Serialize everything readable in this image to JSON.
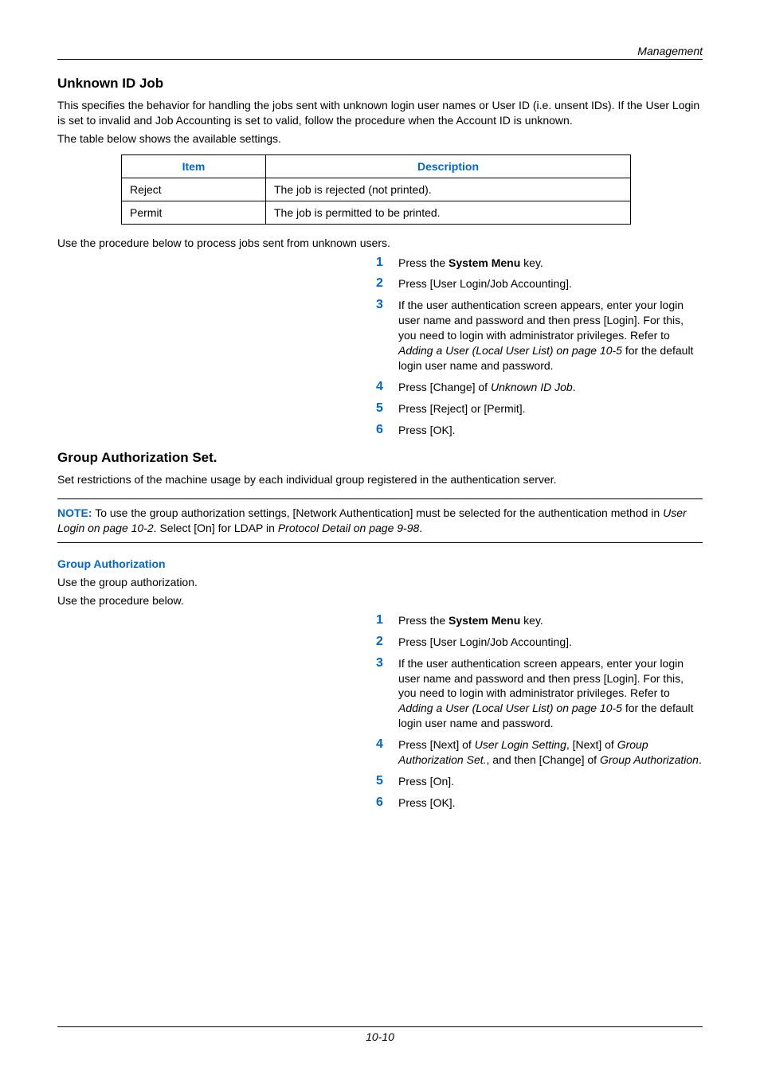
{
  "header": {
    "section_label": "Management"
  },
  "unknown_id": {
    "heading": "Unknown ID Job",
    "para1": "This specifies the behavior for handling the jobs sent with unknown login user names or User ID (i.e. unsent IDs). If the User Login is set to invalid and Job Accounting is set to valid, follow the procedure when the Account ID is unknown.",
    "para2": "The table below shows the available settings.",
    "table": {
      "head_item": "Item",
      "head_desc": "Description",
      "rows": [
        {
          "item": "Reject",
          "desc": "The job is rejected (not printed)."
        },
        {
          "item": "Permit",
          "desc": "The job is permitted to be printed."
        }
      ]
    },
    "para3": "Use the procedure below to process jobs sent from unknown users.",
    "steps": [
      {
        "n": "1",
        "pre": "Press the ",
        "bold": "System Menu",
        "post": " key."
      },
      {
        "n": "2",
        "plain": "Press [User Login/Job Accounting]."
      },
      {
        "n": "3",
        "pre": "If the user authentication screen appears, enter your login user name and password and then press [Login]. For this, you need to login with administrator privileges. Refer to ",
        "italic": "Adding a User (Local User List) on page 10-5",
        "post": " for the default login user name and password."
      },
      {
        "n": "4",
        "pre": "Press [Change] of ",
        "italic": "Unknown ID Job",
        "post": "."
      },
      {
        "n": "5",
        "plain": "Press [Reject] or [Permit]."
      },
      {
        "n": "6",
        "plain": "Press [OK]."
      }
    ]
  },
  "group_auth": {
    "heading": "Group Authorization Set.",
    "para1": "Set restrictions of the machine usage by each individual group registered in the authentication server.",
    "note_label": "NOTE:",
    "note_pre": " To use the group authorization settings, [Network Authentication] must be selected for the authentication method in ",
    "note_italic1": "User Login on page 10-2",
    "note_mid": ". Select [On] for LDAP in ",
    "note_italic2": "Protocol Detail on page 9-98",
    "note_post": ".",
    "sub_heading": "Group Authorization",
    "para2a": "Use the group authorization.",
    "para2b": "Use the procedure below.",
    "steps": [
      {
        "n": "1",
        "pre": "Press the ",
        "bold": "System Menu",
        "post": " key."
      },
      {
        "n": "2",
        "plain": "Press [User Login/Job Accounting]."
      },
      {
        "n": "3",
        "pre": "If the user authentication screen appears, enter your login user name and password and then press [Login]. For this, you need to login with administrator privileges. Refer to ",
        "italic": "Adding a User (Local User List) on page 10-5",
        "post": " for the default login user name and password."
      },
      {
        "n": "4",
        "pre": "Press [Next] of ",
        "italic": "User Login Setting",
        "mid1": ", [Next] of ",
        "italic2": "Group Authorization Set.",
        "mid2": ", and then [Change] of ",
        "italic3": "Group Authorization",
        "post": "."
      },
      {
        "n": "5",
        "plain": "Press [On]."
      },
      {
        "n": "6",
        "plain": "Press [OK]."
      }
    ]
  },
  "footer": {
    "page": "10-10"
  }
}
